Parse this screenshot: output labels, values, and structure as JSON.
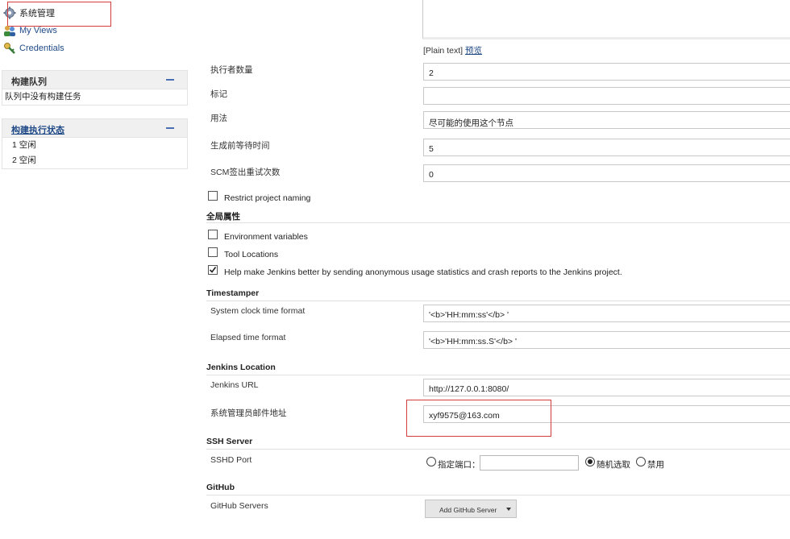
{
  "sidebar": {
    "links": [
      {
        "label": "系统管理",
        "icon": "gear-icon"
      },
      {
        "label": "My Views",
        "icon": "people-icon"
      },
      {
        "label": "Credentials",
        "icon": "key-icon"
      }
    ],
    "build_queue": {
      "title": "构建队列",
      "empty_text": "队列中没有构建任务"
    },
    "executor_status": {
      "title": "构建执行状态",
      "rows": [
        "1  空闲",
        "2  空闲"
      ]
    }
  },
  "description": {
    "format_text": "[Plain text]",
    "preview_link": "预览"
  },
  "fields": {
    "executors": {
      "label": "执行者数量",
      "value": "2"
    },
    "labels": {
      "label": "标记",
      "value": ""
    },
    "usage": {
      "label": "用法",
      "value": "尽可能的使用这个节点"
    },
    "quiet_period": {
      "label": "生成前等待时间",
      "value": "5"
    },
    "scm_retry": {
      "label": "SCM签出重试次数",
      "value": "0"
    }
  },
  "restrict_naming": {
    "label": "Restrict project naming",
    "checked": false
  },
  "global_properties": {
    "title": "全局属性",
    "env_vars": {
      "label": "Environment variables",
      "checked": false
    },
    "tool_locations": {
      "label": "Tool Locations",
      "checked": false
    },
    "usage_stats": {
      "label": "Help make Jenkins better by sending anonymous usage statistics and crash reports to the Jenkins project.",
      "checked": true
    }
  },
  "timestamper": {
    "title": "Timestamper",
    "system_clock": {
      "label": "System clock time format",
      "value": "'<b>'HH:mm:ss'</b> '"
    },
    "elapsed": {
      "label": "Elapsed time format",
      "value": "'<b>'HH:mm:ss.S'</b> '"
    }
  },
  "jenkins_location": {
    "title": "Jenkins Location",
    "url": {
      "label": "Jenkins URL",
      "value": "http://127.0.0.1:8080/"
    },
    "admin_email": {
      "label": "系统管理员邮件地址",
      "value": "xyf9575@163.com"
    }
  },
  "ssh_server": {
    "title": "SSH Server",
    "port_label": "SSHD Port",
    "options": [
      {
        "label": "指定端口：",
        "selected": false
      },
      {
        "label": "随机选取",
        "selected": true
      },
      {
        "label": "禁用",
        "selected": false
      }
    ],
    "port_value": ""
  },
  "github": {
    "title": "GitHub",
    "servers_label": "GitHub Servers",
    "add_button": "Add GitHub Server"
  }
}
